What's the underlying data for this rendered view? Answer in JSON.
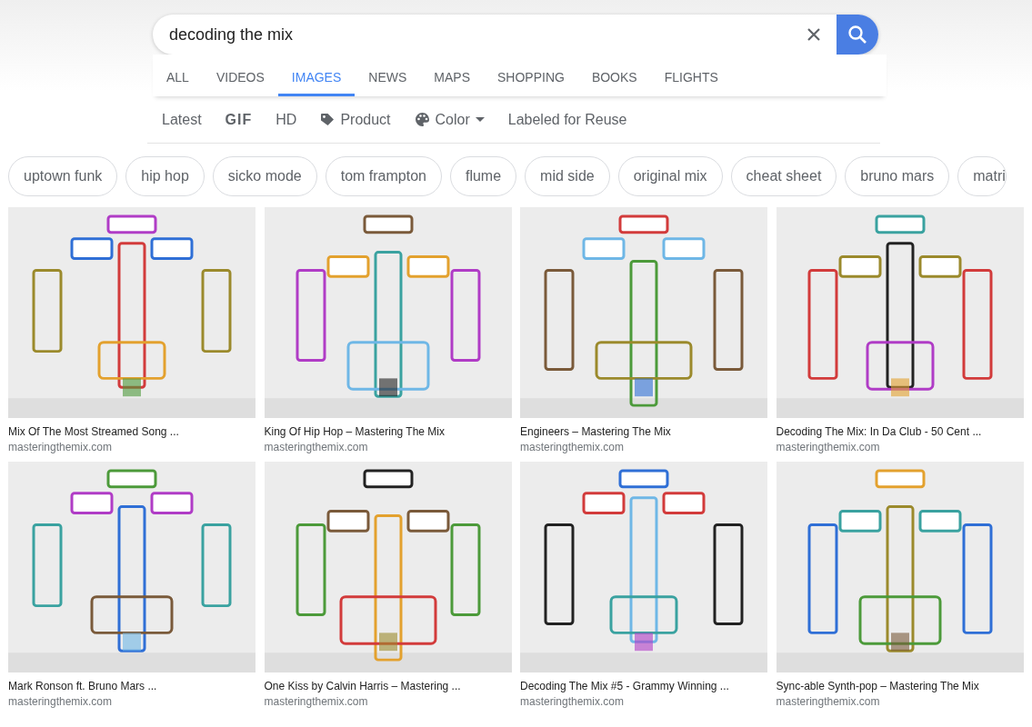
{
  "search": {
    "query": "decoding the mix"
  },
  "tabs": [
    {
      "label": "ALL",
      "selected": false
    },
    {
      "label": "VIDEOS",
      "selected": false
    },
    {
      "label": "IMAGES",
      "selected": true
    },
    {
      "label": "NEWS",
      "selected": false
    },
    {
      "label": "MAPS",
      "selected": false
    },
    {
      "label": "SHOPPING",
      "selected": false
    },
    {
      "label": "BOOKS",
      "selected": false
    },
    {
      "label": "FLIGHTS",
      "selected": false
    }
  ],
  "filters": [
    {
      "label": "Latest",
      "kind": "text"
    },
    {
      "label": "GIF",
      "kind": "gif"
    },
    {
      "label": "HD",
      "kind": "text"
    },
    {
      "label": "Product",
      "kind": "tag"
    },
    {
      "label": "Color",
      "kind": "color"
    },
    {
      "label": "Labeled for Reuse",
      "kind": "text"
    }
  ],
  "chips": [
    "uptown funk",
    "hip hop",
    "sicko mode",
    "tom frampton",
    "flume",
    "mid side",
    "original mix",
    "cheat sheet",
    "bruno mars",
    "matri"
  ],
  "results": [
    {
      "title": "Mix Of The Most Streamed Song ...",
      "source": "masteringthemix.com"
    },
    {
      "title": "King Of Hip Hop – Mastering The Mix",
      "source": "masteringthemix.com"
    },
    {
      "title": "Engineers – Mastering The Mix",
      "source": "masteringthemix.com"
    },
    {
      "title": "Decoding The Mix: In Da Club - 50 Cent ...",
      "source": "masteringthemix.com"
    },
    {
      "title": "Mark Ronson ft. Bruno Mars ...",
      "source": "masteringthemix.com"
    },
    {
      "title": "One Kiss by Calvin Harris – Mastering ...",
      "source": "masteringthemix.com"
    },
    {
      "title": "Decoding The Mix #5 - Grammy Winning ...",
      "source": "masteringthemix.com"
    },
    {
      "title": "Sync-able Synth-pop – Mastering The Mix",
      "source": "masteringthemix.com"
    }
  ]
}
